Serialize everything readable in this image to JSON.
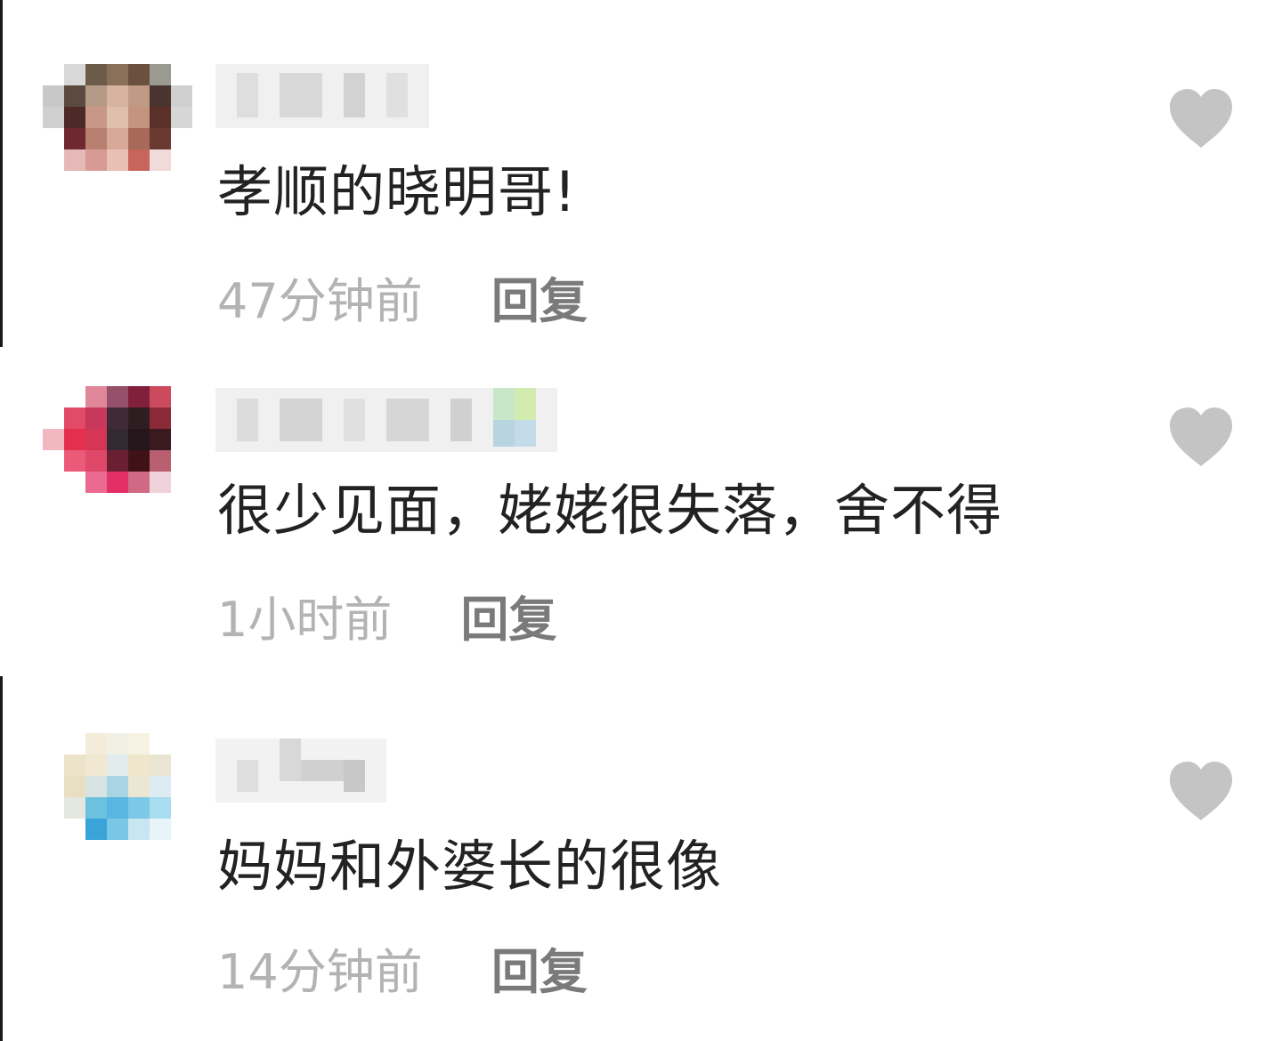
{
  "comments": [
    {
      "username": "",
      "text": "孝顺的晓明哥!",
      "time": "47分钟前",
      "reply_label": "回复"
    },
    {
      "username": "",
      "text": "很少见面，姥姥很失落，舍不得",
      "time": "1小时前",
      "reply_label": "回复"
    },
    {
      "username": "",
      "text": "妈妈和外婆长的很像",
      "time": "14分钟前",
      "reply_label": "回复"
    }
  ],
  "icons": {
    "like": "heart-icon"
  },
  "colors": {
    "comment_text": "#222222",
    "timestamp": "#b3b3b3",
    "reply": "#7a7a7a",
    "heart": "#c4c4c4"
  }
}
